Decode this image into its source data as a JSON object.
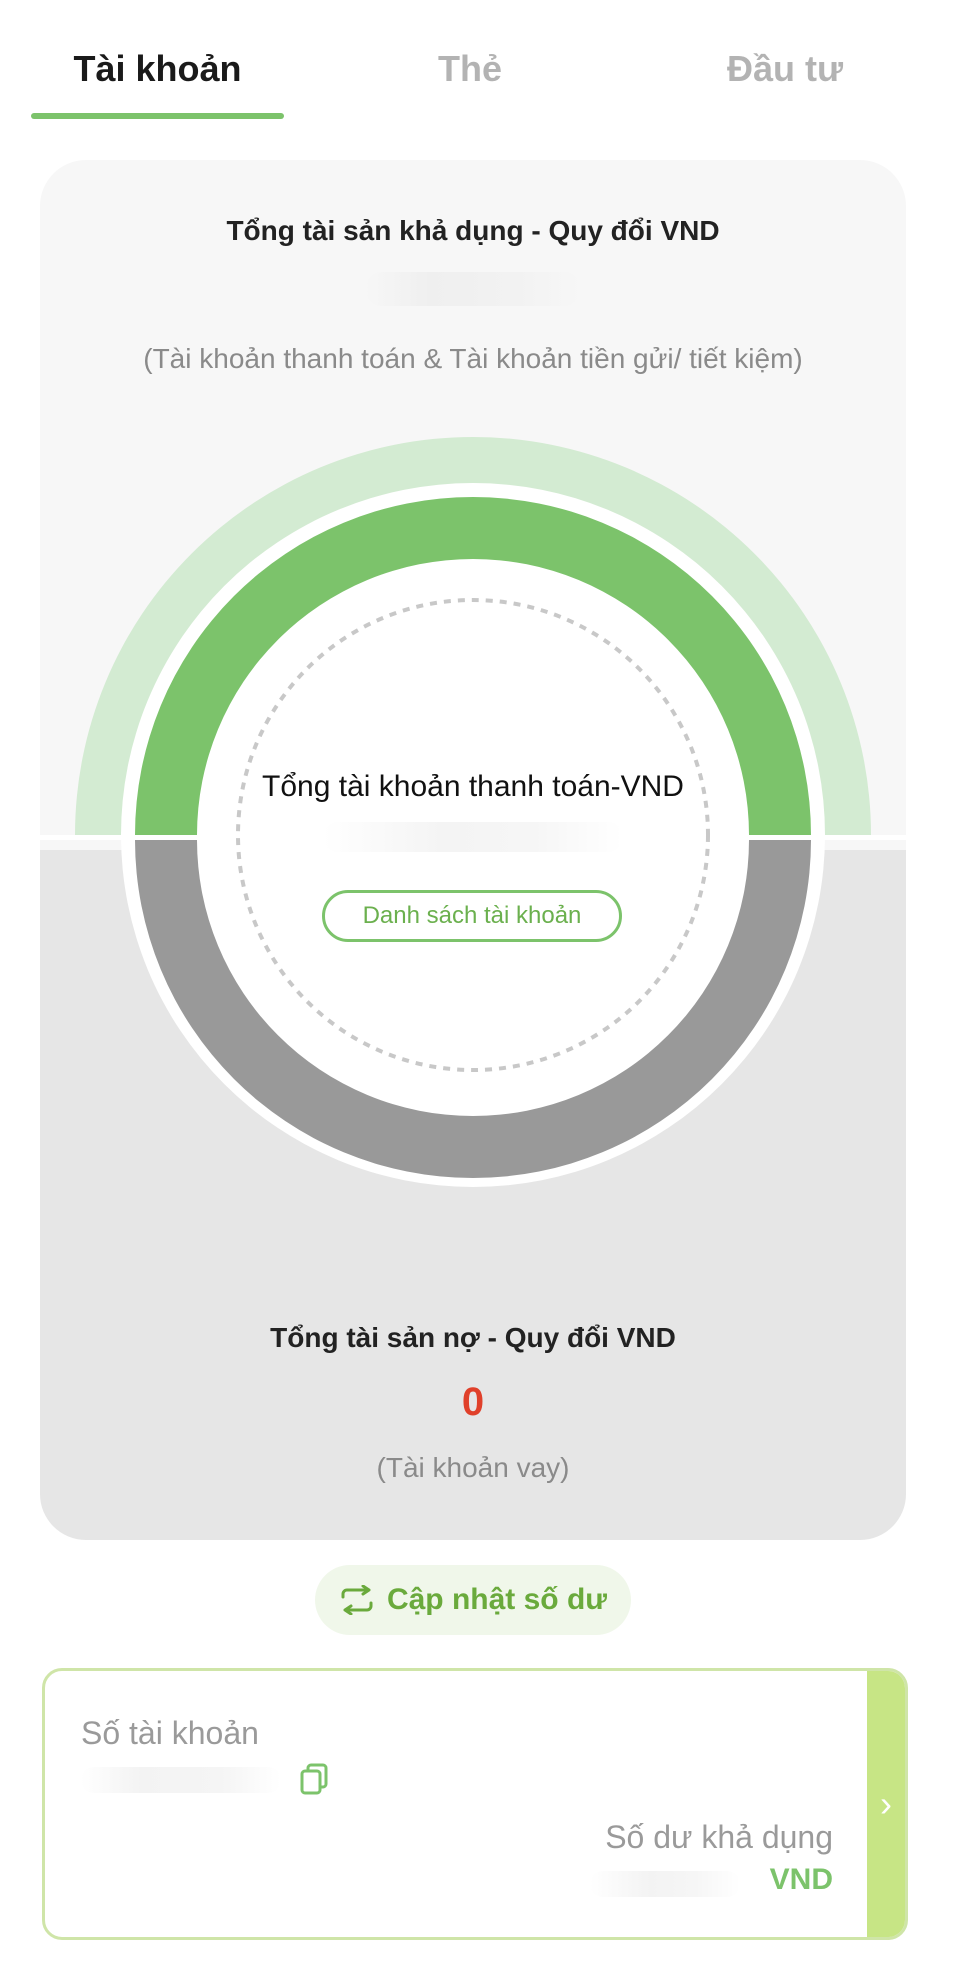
{
  "tabs": [
    {
      "label": "Tài khoản",
      "active": true
    },
    {
      "label": "Thẻ",
      "active": false
    },
    {
      "label": "Đầu tư",
      "active": false
    }
  ],
  "assets": {
    "title": "Tổng tài sản khả dụng - Quy đổi VND",
    "note": "(Tài khoản thanh toán & Tài khoản tiền gửi/ tiết kiệm)"
  },
  "center": {
    "label": "Tổng tài khoản thanh toán-VND",
    "button_label": "Danh sách tài khoản"
  },
  "debt": {
    "title": "Tổng tài sản nợ - Quy đổi VND",
    "value": "0",
    "note": "(Tài khoản vay)"
  },
  "refresh": {
    "label": "Cập nhật số dư",
    "icon": "refresh-arrows-icon"
  },
  "account": {
    "number_label": "Số tài khoản",
    "balance_label": "Số dư khả dụng",
    "currency": "VND",
    "copy_icon": "copy-icon",
    "arrow_icon": "chevron-right-icon"
  },
  "colors": {
    "accent_green": "#7cc36b",
    "light_green": "#d3ebd2",
    "debt_gray": "#999999",
    "debt_red": "#e0402a",
    "arrow_bar": "#c7e585"
  }
}
